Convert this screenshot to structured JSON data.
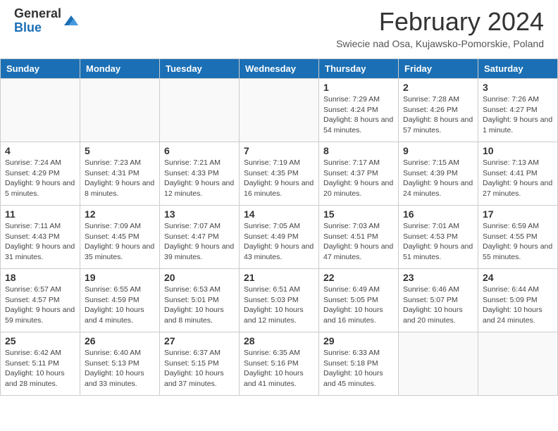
{
  "logo": {
    "general": "General",
    "blue": "Blue"
  },
  "title": "February 2024",
  "subtitle": "Swiecie nad Osa, Kujawsko-Pomorskie, Poland",
  "headers": [
    "Sunday",
    "Monday",
    "Tuesday",
    "Wednesday",
    "Thursday",
    "Friday",
    "Saturday"
  ],
  "weeks": [
    [
      {
        "day": "",
        "info": ""
      },
      {
        "day": "",
        "info": ""
      },
      {
        "day": "",
        "info": ""
      },
      {
        "day": "",
        "info": ""
      },
      {
        "day": "1",
        "info": "Sunrise: 7:29 AM\nSunset: 4:24 PM\nDaylight: 8 hours and 54 minutes."
      },
      {
        "day": "2",
        "info": "Sunrise: 7:28 AM\nSunset: 4:26 PM\nDaylight: 8 hours and 57 minutes."
      },
      {
        "day": "3",
        "info": "Sunrise: 7:26 AM\nSunset: 4:27 PM\nDaylight: 9 hours and 1 minute."
      }
    ],
    [
      {
        "day": "4",
        "info": "Sunrise: 7:24 AM\nSunset: 4:29 PM\nDaylight: 9 hours and 5 minutes."
      },
      {
        "day": "5",
        "info": "Sunrise: 7:23 AM\nSunset: 4:31 PM\nDaylight: 9 hours and 8 minutes."
      },
      {
        "day": "6",
        "info": "Sunrise: 7:21 AM\nSunset: 4:33 PM\nDaylight: 9 hours and 12 minutes."
      },
      {
        "day": "7",
        "info": "Sunrise: 7:19 AM\nSunset: 4:35 PM\nDaylight: 9 hours and 16 minutes."
      },
      {
        "day": "8",
        "info": "Sunrise: 7:17 AM\nSunset: 4:37 PM\nDaylight: 9 hours and 20 minutes."
      },
      {
        "day": "9",
        "info": "Sunrise: 7:15 AM\nSunset: 4:39 PM\nDaylight: 9 hours and 24 minutes."
      },
      {
        "day": "10",
        "info": "Sunrise: 7:13 AM\nSunset: 4:41 PM\nDaylight: 9 hours and 27 minutes."
      }
    ],
    [
      {
        "day": "11",
        "info": "Sunrise: 7:11 AM\nSunset: 4:43 PM\nDaylight: 9 hours and 31 minutes."
      },
      {
        "day": "12",
        "info": "Sunrise: 7:09 AM\nSunset: 4:45 PM\nDaylight: 9 hours and 35 minutes."
      },
      {
        "day": "13",
        "info": "Sunrise: 7:07 AM\nSunset: 4:47 PM\nDaylight: 9 hours and 39 minutes."
      },
      {
        "day": "14",
        "info": "Sunrise: 7:05 AM\nSunset: 4:49 PM\nDaylight: 9 hours and 43 minutes."
      },
      {
        "day": "15",
        "info": "Sunrise: 7:03 AM\nSunset: 4:51 PM\nDaylight: 9 hours and 47 minutes."
      },
      {
        "day": "16",
        "info": "Sunrise: 7:01 AM\nSunset: 4:53 PM\nDaylight: 9 hours and 51 minutes."
      },
      {
        "day": "17",
        "info": "Sunrise: 6:59 AM\nSunset: 4:55 PM\nDaylight: 9 hours and 55 minutes."
      }
    ],
    [
      {
        "day": "18",
        "info": "Sunrise: 6:57 AM\nSunset: 4:57 PM\nDaylight: 9 hours and 59 minutes."
      },
      {
        "day": "19",
        "info": "Sunrise: 6:55 AM\nSunset: 4:59 PM\nDaylight: 10 hours and 4 minutes."
      },
      {
        "day": "20",
        "info": "Sunrise: 6:53 AM\nSunset: 5:01 PM\nDaylight: 10 hours and 8 minutes."
      },
      {
        "day": "21",
        "info": "Sunrise: 6:51 AM\nSunset: 5:03 PM\nDaylight: 10 hours and 12 minutes."
      },
      {
        "day": "22",
        "info": "Sunrise: 6:49 AM\nSunset: 5:05 PM\nDaylight: 10 hours and 16 minutes."
      },
      {
        "day": "23",
        "info": "Sunrise: 6:46 AM\nSunset: 5:07 PM\nDaylight: 10 hours and 20 minutes."
      },
      {
        "day": "24",
        "info": "Sunrise: 6:44 AM\nSunset: 5:09 PM\nDaylight: 10 hours and 24 minutes."
      }
    ],
    [
      {
        "day": "25",
        "info": "Sunrise: 6:42 AM\nSunset: 5:11 PM\nDaylight: 10 hours and 28 minutes."
      },
      {
        "day": "26",
        "info": "Sunrise: 6:40 AM\nSunset: 5:13 PM\nDaylight: 10 hours and 33 minutes."
      },
      {
        "day": "27",
        "info": "Sunrise: 6:37 AM\nSunset: 5:15 PM\nDaylight: 10 hours and 37 minutes."
      },
      {
        "day": "28",
        "info": "Sunrise: 6:35 AM\nSunset: 5:16 PM\nDaylight: 10 hours and 41 minutes."
      },
      {
        "day": "29",
        "info": "Sunrise: 6:33 AM\nSunset: 5:18 PM\nDaylight: 10 hours and 45 minutes."
      },
      {
        "day": "",
        "info": ""
      },
      {
        "day": "",
        "info": ""
      }
    ]
  ]
}
